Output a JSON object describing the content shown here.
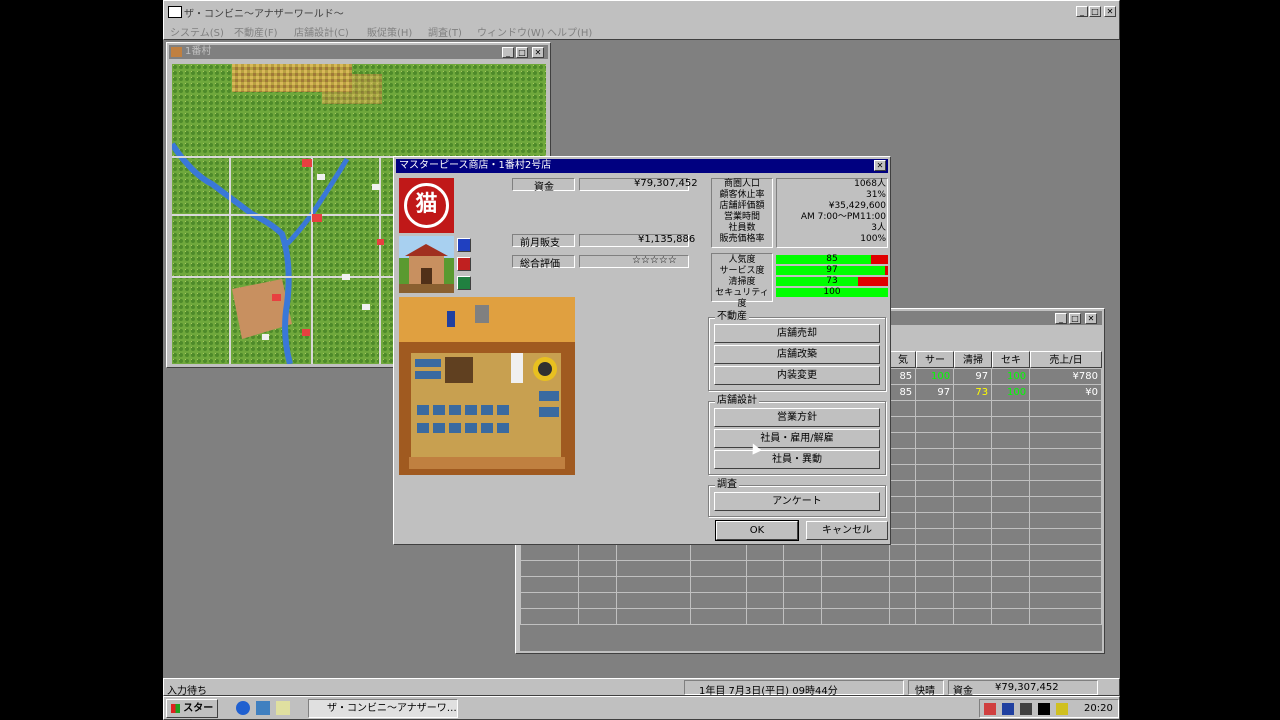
{
  "app": {
    "title": "ザ・コンビニ～アナザーワールド～",
    "menu": [
      "システム(S)",
      "不動産(F)",
      "店舗設計(C)",
      "販促策(H)",
      "調査(T)",
      "ウィンドウ(W)",
      "ヘルプ(H)"
    ]
  },
  "map_window": {
    "title": "1番村"
  },
  "store_dialog": {
    "title": "マスターピース商店・1番村2号店",
    "logo_char": "猫",
    "fields": [
      {
        "label": "資金",
        "value": "¥79,307,452"
      },
      {
        "label": "前月販支",
        "value": "¥1,135,886"
      },
      {
        "label": "総合評価",
        "value": "☆☆☆☆☆"
      }
    ],
    "stats_labels": [
      "商圏人口",
      "顧客休止率",
      "店舗評価額",
      "営業時間",
      "社員数",
      "販売価格率"
    ],
    "stats_values": [
      "1068人",
      "31%",
      "¥35,429,600",
      "AM 7:00～PM11:00",
      "3人",
      "100%"
    ],
    "gauges": [
      {
        "label": "人気度",
        "value": 85,
        "text": "85"
      },
      {
        "label": "サービス度",
        "value": 97,
        "text": "97"
      },
      {
        "label": "清掃度",
        "value": 73,
        "text": "73"
      },
      {
        "label": "セキュリティ度",
        "value": 100,
        "text": "100"
      }
    ],
    "groups": {
      "real_estate": {
        "title": "不動産",
        "buttons": [
          "店舗売却",
          "店舗改築",
          "内装変更"
        ]
      },
      "design": {
        "title": "店舗設計",
        "buttons": [
          "営業方針",
          "社員・雇用/解雇",
          "社員・異動"
        ]
      },
      "survey": {
        "title": "調査",
        "buttons": [
          "アンケート"
        ]
      }
    },
    "ok_label": "OK",
    "cancel_label": "キャンセル"
  },
  "list_window": {
    "headers": [
      "気",
      "サー",
      "清掃",
      "セキ",
      "売上/日"
    ],
    "rows": [
      {
        "cells": [
          "85",
          "100",
          "97",
          "100",
          "¥780"
        ],
        "colors": [
          "w",
          "g",
          "w",
          "g",
          "w"
        ]
      },
      {
        "cells": [
          "85",
          "97",
          "73",
          "100",
          "¥0"
        ],
        "colors": [
          "w",
          "w",
          "y",
          "g",
          "w"
        ]
      }
    ]
  },
  "status_bar": {
    "left": "入力待ち",
    "date": "1年目 7月3日(平日) 09時44分",
    "weather": "快晴",
    "funds_label": "資金",
    "funds": "¥79,307,452"
  },
  "taskbar": {
    "start": "スタート",
    "task": "ザ・コンビニ～アナザーワ…",
    "clock": "20:20"
  },
  "colors": {
    "desktop": "#808080",
    "titlebar_active": "#000080",
    "titlebar_inactive": "#808080",
    "gauge_good": "#00ff00",
    "gauge_bad": "#e00000"
  }
}
